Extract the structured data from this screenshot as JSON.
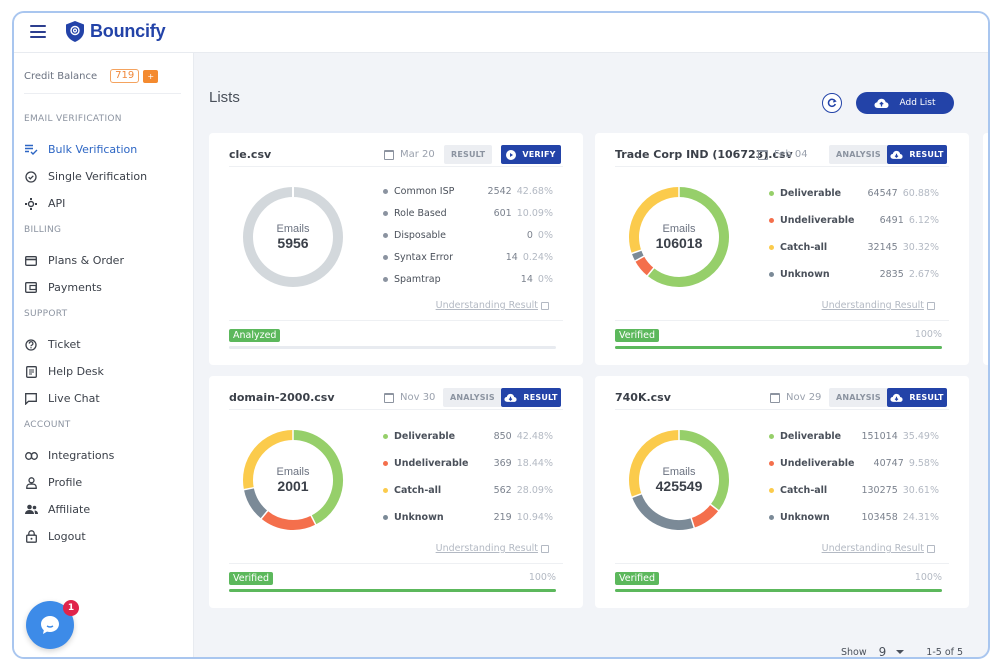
{
  "app": {
    "name": "Bouncify"
  },
  "sidebar": {
    "credit_label": "Credit Balance",
    "credit_value": "719",
    "credit_add": "+",
    "sections": [
      {
        "title": "EMAIL VERIFICATION",
        "items": [
          {
            "label": "Bulk Verification",
            "icon": "bulk-check-icon",
            "active": true
          },
          {
            "label": "Single Verification",
            "icon": "check-circle-icon"
          },
          {
            "label": "API",
            "icon": "api-icon"
          }
        ]
      },
      {
        "title": "BILLING",
        "items": [
          {
            "label": "Plans & Order",
            "icon": "credit-card-icon"
          },
          {
            "label": "Payments",
            "icon": "wallet-icon"
          }
        ]
      },
      {
        "title": "SUPPORT",
        "items": [
          {
            "label": "Ticket",
            "icon": "help-circle-icon"
          },
          {
            "label": "Help Desk",
            "icon": "document-icon"
          },
          {
            "label": "Live Chat",
            "icon": "chat-icon"
          }
        ]
      },
      {
        "title": "ACCOUNT",
        "items": [
          {
            "label": "Integrations",
            "icon": "link-icon"
          },
          {
            "label": "Profile",
            "icon": "user-icon"
          },
          {
            "label": "Affiliate",
            "icon": "users-icon"
          },
          {
            "label": "Logout",
            "icon": "lock-icon"
          }
        ]
      }
    ]
  },
  "chat_widget": {
    "badge": "1"
  },
  "main": {
    "title": "Lists",
    "add_list_label": "Add List",
    "pager": {
      "show_label": "Show",
      "show_value": "9",
      "range": "1-5 of 5"
    }
  },
  "colors": {
    "primary": "#2343a8",
    "deliverable": "#96cf6a",
    "undeliverable": "#f46f4c",
    "catch_all": "#fbcb4c",
    "unknown": "#7b8a97",
    "neutral": "#d3d8dc",
    "success": "#5cb85c"
  },
  "lists": [
    {
      "name": "cle.csv",
      "date": "Mar 20",
      "ghost_label": "RESULT",
      "primary_label": "VERIFY",
      "primary_icon": "play-icon",
      "emails_caption": "Emails",
      "emails_total": "5956",
      "kind": "analysis",
      "legend": [
        {
          "name": "Common ISP",
          "count": "2542",
          "pct": "42.68%"
        },
        {
          "name": "Role Based",
          "count": "601",
          "pct": "10.09%"
        },
        {
          "name": "Disposable",
          "count": "0",
          "pct": "0%"
        },
        {
          "name": "Syntax Error",
          "count": "14",
          "pct": "0.24%"
        },
        {
          "name": "Spamtrap",
          "count": "14",
          "pct": "0%"
        }
      ],
      "understanding_label": "Understanding Result",
      "status": "Analyzed",
      "progress_label": "",
      "progress": 0
    },
    {
      "name": "Trade Corp IND (106723).csv",
      "date": "Feb 04",
      "ghost_label": "ANALYSIS",
      "primary_label": "RESULT",
      "primary_icon": "cloud-download-icon",
      "emails_caption": "Emails",
      "emails_total": "106018",
      "kind": "result",
      "legend": [
        {
          "name": "Deliverable",
          "count": "64547",
          "pct": "60.88%",
          "key": "deliverable",
          "value": 60.88
        },
        {
          "name": "Undeliverable",
          "count": "6491",
          "pct": "6.12%",
          "key": "undeliverable",
          "value": 6.12
        },
        {
          "name": "Catch-all",
          "count": "32145",
          "pct": "30.32%",
          "key": "catch_all",
          "value": 30.32
        },
        {
          "name": "Unknown",
          "count": "2835",
          "pct": "2.67%",
          "key": "unknown",
          "value": 2.67
        }
      ],
      "understanding_label": "Understanding Result",
      "status": "Verified",
      "progress_label": "100%",
      "progress": 100
    },
    {
      "name": "domain-2000.csv",
      "date": "Nov 30",
      "ghost_label": "ANALYSIS",
      "primary_label": "RESULT",
      "primary_icon": "cloud-download-icon",
      "emails_caption": "Emails",
      "emails_total": "2001",
      "kind": "result",
      "legend": [
        {
          "name": "Deliverable",
          "count": "850",
          "pct": "42.48%",
          "key": "deliverable",
          "value": 42.48
        },
        {
          "name": "Undeliverable",
          "count": "369",
          "pct": "18.44%",
          "key": "undeliverable",
          "value": 18.44
        },
        {
          "name": "Catch-all",
          "count": "562",
          "pct": "28.09%",
          "key": "catch_all",
          "value": 28.09
        },
        {
          "name": "Unknown",
          "count": "219",
          "pct": "10.94%",
          "key": "unknown",
          "value": 10.94
        }
      ],
      "understanding_label": "Understanding Result",
      "status": "Verified",
      "progress_label": "100%",
      "progress": 100
    },
    {
      "name": "740K.csv",
      "date": "Nov 29",
      "ghost_label": "ANALYSIS",
      "primary_label": "RESULT",
      "primary_icon": "cloud-download-icon",
      "emails_caption": "Emails",
      "emails_total": "425549",
      "kind": "result",
      "legend": [
        {
          "name": "Deliverable",
          "count": "151014",
          "pct": "35.49%",
          "key": "deliverable",
          "value": 35.49
        },
        {
          "name": "Undeliverable",
          "count": "40747",
          "pct": "9.58%",
          "key": "undeliverable",
          "value": 9.58
        },
        {
          "name": "Catch-all",
          "count": "130275",
          "pct": "30.61%",
          "key": "catch_all",
          "value": 30.61
        },
        {
          "name": "Unknown",
          "count": "103458",
          "pct": "24.31%",
          "key": "unknown",
          "value": 24.31
        }
      ],
      "understanding_label": "Understanding Result",
      "status": "Verified",
      "progress_label": "100%",
      "progress": 100
    }
  ]
}
